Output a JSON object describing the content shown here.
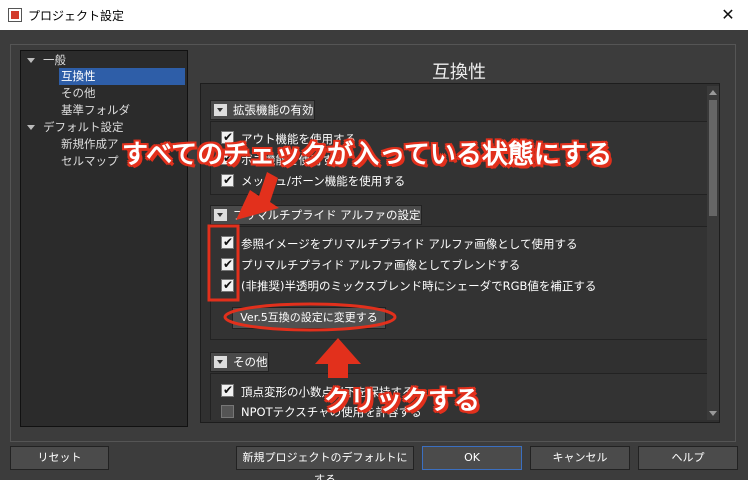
{
  "window": {
    "title": "プロジェクト設定",
    "close": "✕"
  },
  "tree": [
    {
      "label": "一般"
    },
    {
      "label": "互換性"
    },
    {
      "label": "その他"
    },
    {
      "label": "基準フォルダ"
    },
    {
      "label": "デフォルト設定"
    },
    {
      "label": "新規作成ア"
    },
    {
      "label": "セルマップ"
    }
  ],
  "heading": "互換性",
  "groups": {
    "ext": {
      "title": "拡張機能の有効",
      "items": [
        "アウト機能を使用する",
        "ボス機能を使用する",
        "メッシュ/ボーン機能を使用する"
      ]
    },
    "alpha": {
      "title": "プリマルチプライド アルファの設定",
      "items": [
        "参照イメージをプリマルチプライド アルファ画像として使用する",
        "プリマルチプライド アルファ画像としてブレンドする",
        "(非推奨)半透明のミックスブレンド時にシェーダでRGB値を補正する"
      ],
      "button": "Ver.5互換の設定に変更する"
    },
    "other": {
      "title": "その他",
      "items": [
        "頂点変形の小数点以下を保持する",
        "NPOTテクスチャの使用を許容する"
      ]
    }
  },
  "buttons": {
    "reset": "リセット",
    "default": "新規プロジェクトのデフォルトにする",
    "ok": "OK",
    "cancel": "キャンセル",
    "help": "ヘルプ"
  },
  "annotations": {
    "top": "すべてのチェックが入っている状態にする",
    "bottom": "クリックする"
  },
  "colors": {
    "accent": "#e2301c",
    "selection": "#2e5ea8",
    "panel": "#303030"
  }
}
